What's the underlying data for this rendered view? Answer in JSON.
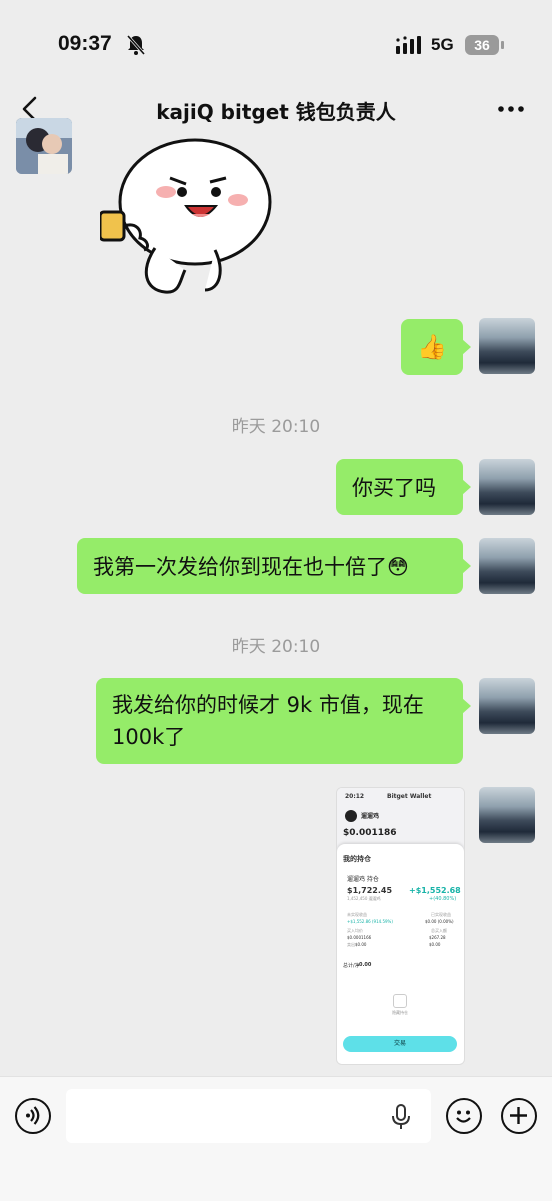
{
  "status_bar": {
    "time": "09:37",
    "network": "5G",
    "battery": "36"
  },
  "header": {
    "title": "kajiQ bitget 钱包负责人"
  },
  "messages": {
    "thumbs_up": "👍",
    "ts1": "昨天 20:10",
    "msg1": "你买了吗",
    "msg2": "我第一次发给你到现在也十倍了😳",
    "ts2": "昨天 20:10",
    "msg3": "我发给你的时候才 9k 市值，现在 100k了"
  },
  "screenshot": {
    "time": "20:12",
    "app": "Bitget Wallet",
    "token": "遛遛鸡",
    "price": "$0.001186",
    "sheet_title": "我的持仓",
    "holding_label": "遛遛鸡 持仓",
    "value": "$1,722.45",
    "amount": "1,452,450 遛遛鸡",
    "pnl": "+$1,552.68",
    "pnl_pct": "+(40.80%)",
    "unrealized_label": "未实现收益",
    "unrealized": "+$1,552.86 (914.59%)",
    "realized_label": "已实现收益",
    "realized": "$0.00 (0.00%)",
    "buy_label": "买入均价",
    "buy": "$0.0001166",
    "sell_label": "卖出",
    "sell": "$0.00",
    "total_buy_label": "总买入额",
    "total_buy": "$267.28",
    "total_sell": "$0.00",
    "total_label": "总计/净",
    "total": "0.00",
    "hidden_label": "隐藏持仓",
    "trade_button": "交易"
  },
  "composer": {
    "placeholder": ""
  }
}
